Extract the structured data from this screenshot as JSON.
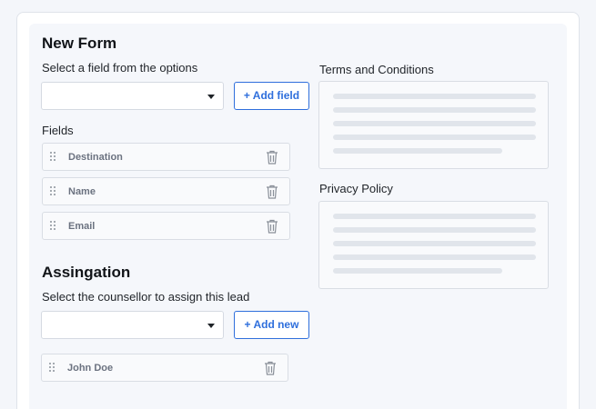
{
  "form": {
    "title": "New Form",
    "select_prompt": "Select a field from the options",
    "add_field_label": "+ Add field",
    "fields_heading": "Fields",
    "fields": [
      {
        "label": "Destination"
      },
      {
        "label": "Name"
      },
      {
        "label": "Email"
      }
    ]
  },
  "assignation": {
    "title": "Assingation",
    "select_prompt": "Select the counsellor to assign this lead",
    "add_new_label": "+ Add new",
    "assignees": [
      {
        "label": "John Doe"
      }
    ]
  },
  "terms": {
    "heading": "Terms and Conditions"
  },
  "privacy": {
    "heading": "Privacy Policy"
  },
  "colors": {
    "accent": "#2f6fdc",
    "panel": "#f5f7fb",
    "border": "#d9dde4",
    "placeholder_line": "#e1e5eb"
  },
  "icons": [
    "drag-handle-icon",
    "trash-icon",
    "chevron-down-icon"
  ]
}
